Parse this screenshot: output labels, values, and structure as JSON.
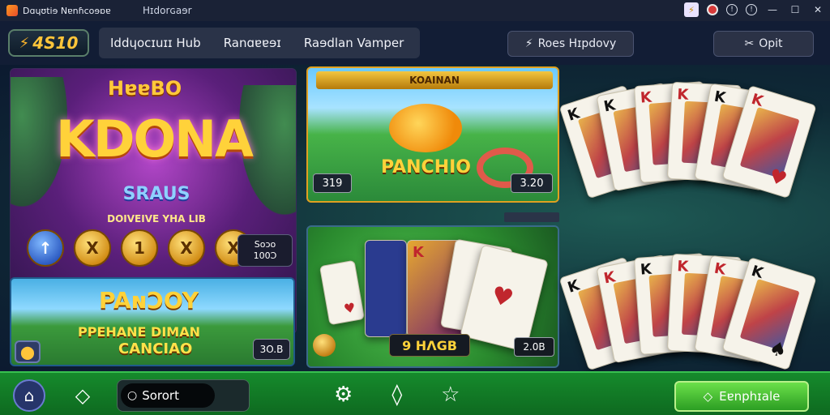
{
  "window": {
    "brand": "Dɑɥʊtiɘ Nɐnɦcoɘɒɐ",
    "title": "Hɪdorɢaɘr",
    "controls": [
      "warning-icon",
      "user-icon",
      "info-icon",
      "info-icon",
      "minimize-icon",
      "maximize-icon",
      "close-icon"
    ]
  },
  "topnav": {
    "coin_icon": "⚡",
    "balance": "4S10",
    "tabs": [
      "Iddɥocɪuɪɪ Hub",
      "Ranɑɐɐɘɪ",
      "Raɘdlan Vamper"
    ],
    "history": {
      "icon": "⚡",
      "label": "Roes Hɪpdovy"
    },
    "exit": {
      "icon": "✂",
      "label": "Opit"
    }
  },
  "games": {
    "kdona": {
      "top": "HɐɐBO",
      "title": "KDONA",
      "subtitle": "SRAUS",
      "tagline": "DOIVEIVE YHA LIB",
      "coins": [
        "↑",
        "Ⅹ",
        "1",
        "X",
        "X",
        "Ƨ"
      ],
      "stake_label": "Soɔo",
      "stake_value": "100Ɔ"
    },
    "pancho": {
      "title": "PAɴƆOY",
      "line2": "PPEHANE DIMAN",
      "line3": "CANCIAO",
      "icon": "⬤",
      "amount": "3O.B"
    },
    "panchio": {
      "banner": "KOAINAN",
      "title": "PANCHIO",
      "amount_left": "319",
      "amount_right": "3.20"
    },
    "cardgame": {
      "amount_left": "9 HΛGB",
      "amount_right": "2.0B"
    }
  },
  "cards_top": [
    {
      "rank": "K",
      "suit": "♠"
    },
    {
      "rank": "K",
      "suit": "♠"
    },
    {
      "rank": "K",
      "suit": "♥"
    },
    {
      "rank": "K",
      "suit": "♥"
    },
    {
      "rank": "K",
      "suit": "♠"
    },
    {
      "rank": "K",
      "suit": "♥"
    }
  ],
  "cards_bottom": [
    {
      "rank": "K",
      "suit": "♠"
    },
    {
      "rank": "K",
      "suit": "♥"
    },
    {
      "rank": "K",
      "suit": "♠"
    },
    {
      "rank": "K",
      "suit": "♥"
    },
    {
      "rank": "K",
      "suit": "♥"
    },
    {
      "rank": "K",
      "suit": "♠"
    }
  ],
  "bottombar": {
    "home_icon": "⌂",
    "diamond_icon": "◇",
    "search_glyph": "○",
    "search_label": "Sorort",
    "mid_icons": [
      "⚙",
      "◊",
      "☆"
    ],
    "action": {
      "icon": "◇",
      "label": "Eɐnphɪale"
    }
  },
  "colors": {
    "accent_gold": "#ffc53a",
    "bottom_green": "#168a2c",
    "action_green": "#2c9e23",
    "card_red": "#c0262d"
  }
}
